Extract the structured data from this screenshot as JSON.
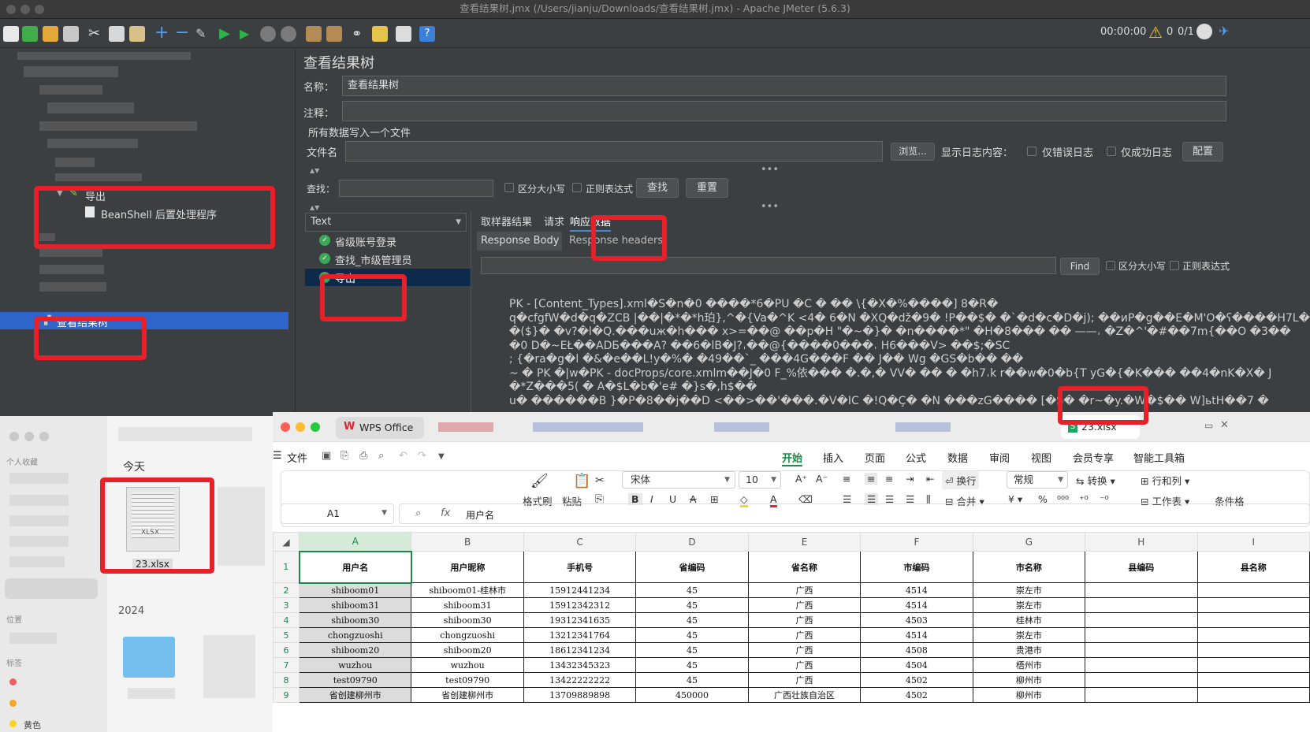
{
  "jmeter": {
    "window_title": "查看结果树.jmx (/Users/jianju/Downloads/查看结果树.jmx) - Apache JMeter (5.6.3)",
    "timer": "00:00:00",
    "warnings": "0",
    "threads": "0/1",
    "tree": {
      "export_label": "导出",
      "beanshell_label": "BeanShell 后置处理程序",
      "results_tree_label": "查看结果树"
    },
    "panel": {
      "title": "查看结果树",
      "name_label": "名称：",
      "name_value": "查看结果树",
      "comment_label": "注释：",
      "write_all_label": "所有数据写入一个文件",
      "filename_label": "文件名",
      "browse_button": "浏览...",
      "show_log_label": "显示日志内容：",
      "errors_only": "仅错误日志",
      "success_only": "仅成功日志",
      "config_button": "配置",
      "search_label": "查找：",
      "case_sensitive": "区分大小写",
      "regex": "正则表达式",
      "find_button": "查找",
      "reset_button": "重置",
      "renderer": "Text",
      "samples": [
        "省级账号登录",
        "查找_市级管理员",
        "导出"
      ],
      "tab_sampler_result": "取样器结果",
      "tab_request": "请求",
      "tab_response": "响应数据",
      "subtab_body": "Response Body",
      "subtab_headers": "Response headers",
      "find_button2": "Find",
      "case_sensitive2": "区分大小写",
      "regex2": "正则表达式",
      "response_lines": [
        "PK  - [Content_Types].xml�S�n�0 ����*6�PU �C � �� \\{�X�%����] 8�R�",
        "q�cfgfW�d�q�ZCB |��|�*�*h珀},^�{Va�^K <4� 6�N �XQ�dž�9� !P��$� �`�d�c�D�j); ��иP�g��E�M'O�ʕ����H7L�r",
        " �($}� �v?�l�Q.���uж�h��� x>=��@ ��p�H \"�~�}�      �n����*\"  �H�8���  �� ——𐄀 �Z�^'�#��7m{��O �3��",
        "�0 D�~EŁ��ADƂ���A? ��6�lB�J?𐄀��@{����0���𐄀 H6���V> ��$;�SC",
        " ; {�ra�g�l �&�e��L!y�%�  �49��`_ ���4G���F �� J�� Wg   �GS�b��  ��",
        "~ � PK �|w�PK  - docProps/core.xmlm��J�0 F_%依��� �.�,� VV�  �� � �h7𐄀k  r��w�0�b{T yG�{�K���  ��4�nK�X�  J",
        "�*Z���5( � A�$L�b�'e# �}s�,h$��",
        "u� ������B }�P�8��j��D <��>��'���.�V�IC �!Q�Ç� �N ���zG����     [�S� �r~�y.�W�$��  W]ьtH��7 �"
      ]
    }
  },
  "finder": {
    "favorites_label": "个人收藏",
    "location_label": "位置",
    "tags_label": "标签",
    "yellow_tag": "黄色",
    "today_label": "今天",
    "file_name": "23.xlsx",
    "file_ext": "XLSX",
    "year_label": "2024"
  },
  "wps": {
    "app_tab": "WPS Office",
    "file_tab": "23.xlsx",
    "menu_file": "文件",
    "ribbon_tabs": [
      "开始",
      "插入",
      "页面",
      "公式",
      "数据",
      "审阅",
      "视图",
      "会员专享",
      "智能工具箱"
    ],
    "ribbon": {
      "format_painter": "格式刷",
      "paste": "粘贴",
      "font": "宋体",
      "font_size": "10",
      "wrap": "换行",
      "merge": "合并",
      "number_format": "常规",
      "convert": "转换",
      "rows_cols": "行和列",
      "worksheet": "工作表",
      "conditional": "条件格"
    },
    "cell_ref": "A1",
    "formula_value": "用户名",
    "columns": [
      "A",
      "B",
      "C",
      "D",
      "E",
      "F",
      "G",
      "H",
      "I"
    ],
    "header_row": [
      "用户名",
      "用户昵称",
      "手机号",
      "省编码",
      "省名称",
      "市编码",
      "市名称",
      "县编码",
      "县名称"
    ],
    "rows": [
      [
        "shiboom01",
        "shiboom01-桂林市",
        "15912441234",
        "45",
        "广西",
        "4514",
        "崇左市",
        "",
        ""
      ],
      [
        "shiboom31",
        "shiboom31",
        "15912342312",
        "45",
        "广西",
        "4514",
        "崇左市",
        "",
        ""
      ],
      [
        "shiboom30",
        "shiboom30",
        "19312341635",
        "45",
        "广西",
        "4503",
        "桂林市",
        "",
        ""
      ],
      [
        "chongzuoshi",
        "chongzuoshi",
        "13212341764",
        "45",
        "广西",
        "4514",
        "崇左市",
        "",
        ""
      ],
      [
        "shiboom20",
        "shiboom20",
        "18612341234",
        "45",
        "广西",
        "4508",
        "贵港市",
        "",
        ""
      ],
      [
        "wuzhou",
        "wuzhou",
        "13432345323",
        "45",
        "广西",
        "4504",
        "梧州市",
        "",
        ""
      ],
      [
        "test09790",
        "test09790",
        "13422222222",
        "45",
        "广西",
        "4502",
        "柳州市",
        "",
        ""
      ],
      [
        "省创建柳州市",
        "省创建柳州市",
        "13709889898",
        "450000",
        "广西壮族自治区",
        "4502",
        "柳州市",
        "",
        ""
      ]
    ]
  }
}
